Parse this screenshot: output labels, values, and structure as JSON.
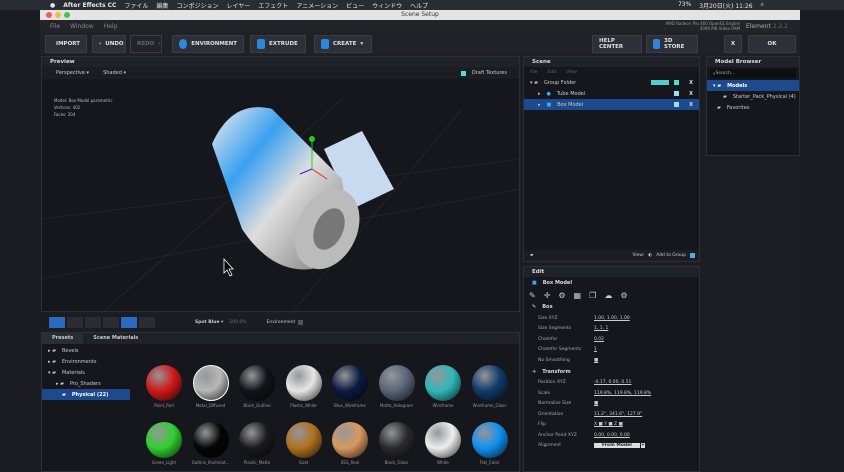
{
  "macbar": {
    "app": "After Effects CC",
    "menus": [
      "ファイル",
      "編集",
      "コンポジション",
      "レイヤー",
      "エフェクト",
      "アニメーション",
      "ビュー",
      "ウィンドウ",
      "ヘルプ"
    ],
    "battery": "73%",
    "datetime": "3月20日(火) 11:26"
  },
  "window": {
    "title": "Scene Setup",
    "menu": [
      "File",
      "Window",
      "Help"
    ],
    "gpu_line1": "AMD Radeon Pro 460 OpenGL Engine",
    "gpu_line2": "4096 MB Video RAM",
    "element_label": "Element",
    "element_version": "2.2.2"
  },
  "toolbar": {
    "import": "IMPORT",
    "undo": "UNDO",
    "redo": "REDO",
    "environment": "ENVIRONMENT",
    "extrude": "EXTRUDE",
    "create": "CREATE",
    "help_center": "HELP CENTER",
    "store": "3D STORE",
    "close": "X",
    "ok": "OK"
  },
  "preview": {
    "title": "Preview",
    "camera": "Perspective",
    "shading": "Shaded",
    "draft_textures": "Draft Textures",
    "info_model_label": "Model:",
    "info_model": "Box Model parametric",
    "info_vertices_label": "Vertices:",
    "info_vertices": "402",
    "info_faces_label": "Faces:",
    "info_faces": "204",
    "light": "Spot Blue",
    "light_value": "100.0%",
    "environment": "Environment"
  },
  "scene": {
    "title": "Scene",
    "menu": [
      "File",
      "Edit",
      "View"
    ],
    "items": [
      {
        "label": "Group Folder"
      },
      {
        "label": "Tube Model"
      },
      {
        "label": "Box Model"
      }
    ],
    "view": "View:",
    "add_to_group": "Add to Group"
  },
  "model_browser": {
    "title": "Model Browser",
    "search_placeholder": "Search...",
    "items": [
      "Models",
      "Starter_Pack_Physical (4)",
      "Favorites"
    ]
  },
  "presets": {
    "tabs": [
      "Presets",
      "Scene Materials"
    ],
    "tree": [
      "Bevels",
      "Environments",
      "Materials",
      "Pro_Shaders",
      "Physical (22)"
    ]
  },
  "materials": [
    {
      "name": "Paint_Red",
      "color": "#d01818"
    },
    {
      "name": "Metal_Diffused",
      "color": "#b8b8b8"
    },
    {
      "name": "Black_Outline",
      "color": "#111418"
    },
    {
      "name": "Plastic_White",
      "color": "#e6e6e6"
    },
    {
      "name": "Blue_Wireframe",
      "color": "#0d1a40"
    },
    {
      "name": "Matte_Hologram",
      "color": "#5a6478"
    },
    {
      "name": "Wireframe",
      "color": "#30b8b8"
    },
    {
      "name": "Wireframe_Glass",
      "color": "#113a6a"
    },
    {
      "name": "Green_Light",
      "color": "#30d030"
    },
    {
      "name": "Outline_Illuminat...",
      "color": "#050505"
    },
    {
      "name": "Plastic_Matte",
      "color": "#1a1a1c"
    },
    {
      "name": "Gold",
      "color": "#b07020"
    },
    {
      "name": "SSS_Real",
      "color": "#d89860"
    },
    {
      "name": "Black_Gloss",
      "color": "#2a2a2c"
    },
    {
      "name": "White",
      "color": "#eeeeee"
    },
    {
      "name": "Flat_Color",
      "color": "#1090f0"
    }
  ],
  "edit": {
    "title": "Edit",
    "object": "Box Model",
    "box_section": "Box",
    "box_props": [
      {
        "k": "Size XYZ",
        "v": "1.00, 1.00, 1.00"
      },
      {
        "k": "Size Segments",
        "v": "1, 1, 1"
      },
      {
        "k": "Chamfer",
        "v": "0.02"
      },
      {
        "k": "Chamfer Segments",
        "v": "1"
      },
      {
        "k": "No Smoothing",
        "v": "■"
      }
    ],
    "transform_section": "Transform",
    "transform_props": [
      {
        "k": "Position XYZ",
        "v": "-0.17, 0.00, 0.51"
      },
      {
        "k": "Scale",
        "v": "119.8%, 119.8%, 119.8%"
      },
      {
        "k": "Normalize Size",
        "v": "■"
      },
      {
        "k": "Orientation",
        "v": "11.2°, 341.6°, 127.9°"
      },
      {
        "k": "Flip",
        "v": "X ■  Y ■  Z ■"
      },
      {
        "k": "Anchor Point XYZ",
        "v": "0.00, 0.00, 0.00"
      }
    ],
    "alignment_label": "Alignment",
    "alignment": "From Model"
  }
}
